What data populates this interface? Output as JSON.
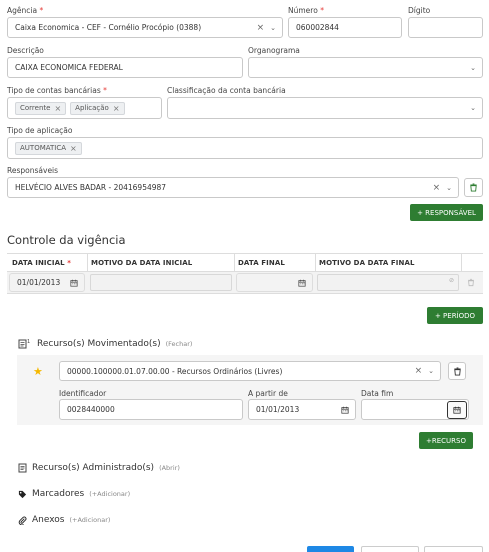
{
  "agencia": {
    "label": "Agência",
    "value": "Caixa Economica - CEF - Cornélio Procópio (0388)"
  },
  "numero": {
    "label": "Número",
    "value": "060002844"
  },
  "digito": {
    "label": "Dígito",
    "value": ""
  },
  "descricao": {
    "label": "Descrição",
    "value": "CAIXA ECONOMICA FEDERAL"
  },
  "organograma": {
    "label": "Organograma",
    "value": ""
  },
  "tipo_contas": {
    "label": "Tipo de contas bancárias",
    "tags": [
      "Corrente",
      "Aplicação"
    ]
  },
  "classificacao": {
    "label": "Classificação da conta bancária",
    "value": ""
  },
  "tipo_aplicacao": {
    "label": "Tipo de aplicação",
    "tags": [
      "AUTOMATICA"
    ]
  },
  "responsaveis": {
    "label": "Responsáveis",
    "value": "HELVÉCIO ALVES BADAR - 20416954987",
    "button": "+ RESPONSÁVEL"
  },
  "vigencia": {
    "title": "Controle da vigência",
    "columns": [
      "DATA INICIAL",
      "MOTIVO DA DATA INICIAL",
      "DATA FINAL",
      "MOTIVO DA DATA FINAL"
    ],
    "row": {
      "data_inicial": "01/01/2013",
      "motivo_inicial": "",
      "data_final": "",
      "motivo_final": ""
    },
    "button": "+ PERÍODO"
  },
  "recursos_mov": {
    "title": "Recurso(s) Movimentado(s)",
    "toggle": "(Fechar)",
    "select_value": "00000.100000.01.07.00.00 - Recursos Ordinários (Livres)",
    "identificador_label": "Identificador",
    "identificador_value": "0028440000",
    "a_partir_label": "A partir de",
    "a_partir_value": "01/01/2013",
    "data_fim_label": "Data fim",
    "data_fim_value": "",
    "button": "+RECURSO"
  },
  "recursos_adm": {
    "title": "Recurso(s) Administrado(s)",
    "toggle": "(Abrir)"
  },
  "marcadores": {
    "title": "Marcadores",
    "toggle": "(+Adicionar)"
  },
  "anexos": {
    "title": "Anexos",
    "toggle": "(+Adicionar)"
  },
  "colors": {
    "accent_green": "#2e7d32",
    "primary_blue": "#1e88e5",
    "star": "#f5b800",
    "required": "#e53935"
  }
}
